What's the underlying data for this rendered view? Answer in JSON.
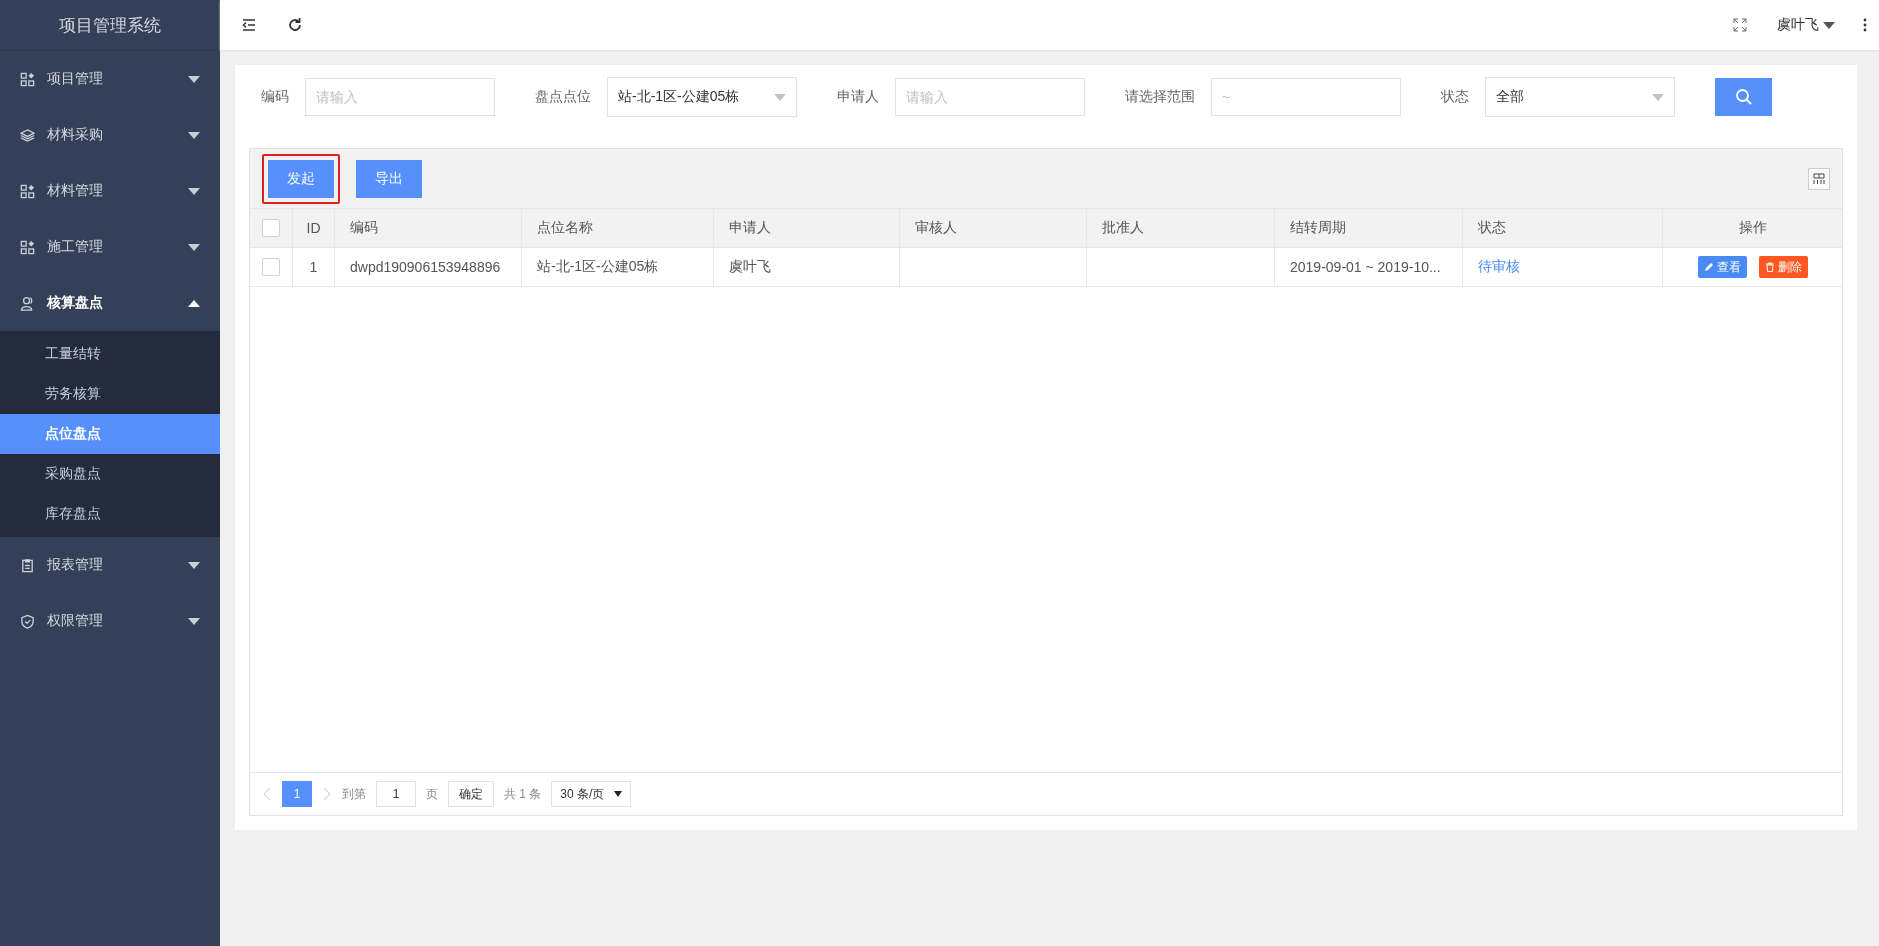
{
  "sidebar": {
    "title": "项目管理系统",
    "items": [
      {
        "label": "项目管理",
        "expanded": false
      },
      {
        "label": "材料采购",
        "expanded": false
      },
      {
        "label": "材料管理",
        "expanded": false
      },
      {
        "label": "施工管理",
        "expanded": false
      },
      {
        "label": "核算盘点",
        "expanded": true,
        "children": [
          {
            "label": "工量结转",
            "selected": false
          },
          {
            "label": "劳务核算",
            "selected": false
          },
          {
            "label": "点位盘点",
            "selected": true
          },
          {
            "label": "采购盘点",
            "selected": false
          },
          {
            "label": "库存盘点",
            "selected": false
          }
        ]
      },
      {
        "label": "报表管理",
        "expanded": false
      },
      {
        "label": "权限管理",
        "expanded": false
      }
    ]
  },
  "topbar": {
    "user": "虞叶飞"
  },
  "filters": [
    {
      "kind": "input",
      "label": "编码",
      "placeholder": "请输入"
    },
    {
      "kind": "select",
      "label": "盘点点位",
      "value": "站-北-1区-公建05栋"
    },
    {
      "kind": "input",
      "label": "申请人",
      "placeholder": "请输入"
    },
    {
      "kind": "input",
      "label": "请选择范围",
      "placeholder": "~"
    },
    {
      "kind": "select",
      "label": "状态",
      "value": "全部"
    }
  ],
  "toolbar": {
    "buttons": [
      {
        "label": "发起",
        "highlighted": true
      },
      {
        "label": "导出",
        "highlighted": false
      }
    ]
  },
  "table": {
    "columns": [
      "ID",
      "编码",
      "点位名称",
      "申请人",
      "审核人",
      "批准人",
      "结转周期",
      "状态",
      "操作"
    ],
    "rows": [
      {
        "checked": false,
        "cells": [
          "1",
          "dwpd190906153948896",
          "站-北-1区-公建05栋",
          "虞叶飞",
          "",
          "",
          "2019-09-01 ~ 2019-10..."
        ],
        "status": "待审核",
        "actions": [
          "查看",
          "删除"
        ]
      }
    ],
    "header_checked": false
  },
  "pagination": {
    "pages": [
      {
        "label": "1",
        "selected": true
      }
    ],
    "goto_label": "到第",
    "goto_value": "1",
    "page_unit": "页",
    "confirm": "确定",
    "total": "共 1 条",
    "page_size": "30 条/页"
  }
}
